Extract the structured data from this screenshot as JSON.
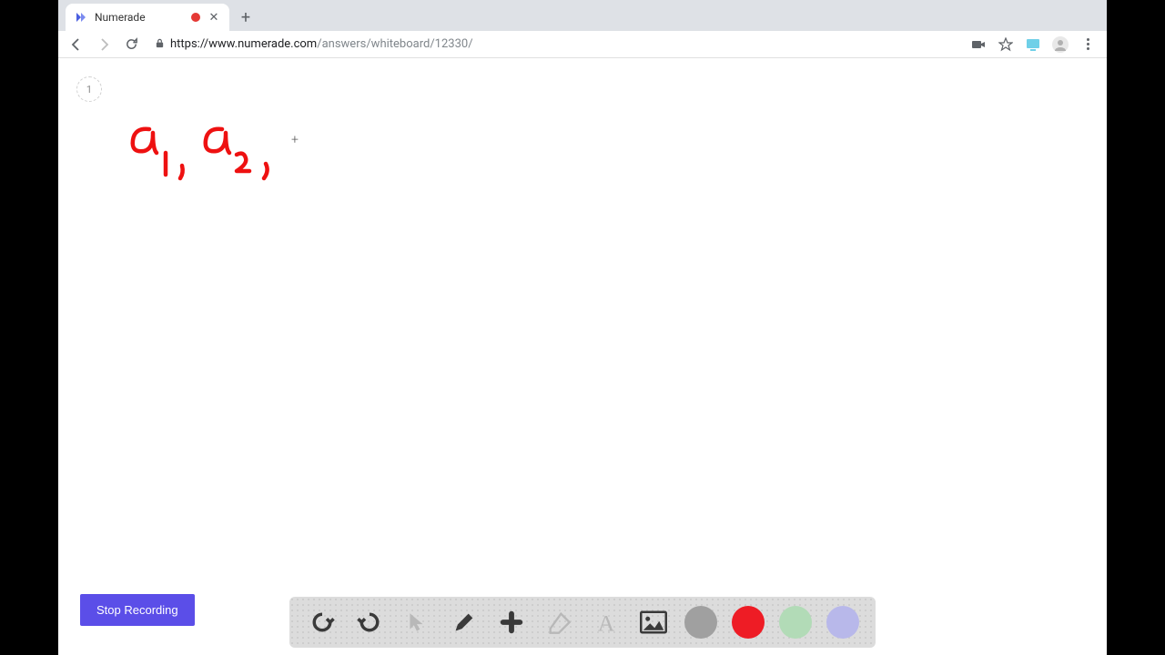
{
  "tab": {
    "title": "Numerade"
  },
  "address": {
    "base": "https://www.numerade.com",
    "path": "/answers/whiteboard/12330/"
  },
  "page": {
    "badge": "1"
  },
  "buttons": {
    "stop_recording": "Stop Recording"
  },
  "tools": {
    "undo": "undo",
    "redo": "redo",
    "pointer": "pointer",
    "pencil": "pencil",
    "add": "add",
    "eraser": "eraser",
    "text": "text",
    "image": "image"
  },
  "colors": {
    "gray": "#a0a0a0",
    "red": "#ee1c25",
    "green": "#b2dbb7",
    "purple": "#b8b8ea"
  },
  "handwriting_label": "a_1 , a_2 ,"
}
